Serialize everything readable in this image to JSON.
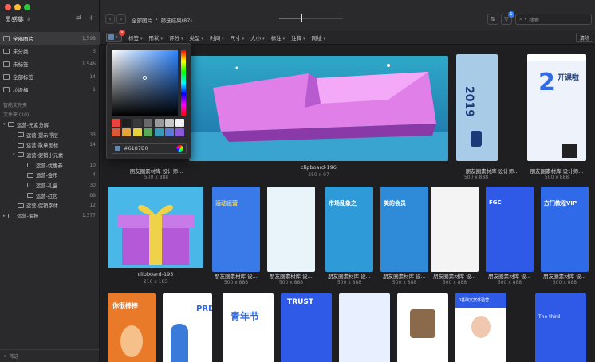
{
  "sidebar": {
    "library_title": "灵感集",
    "nav": [
      {
        "label": "全部图片",
        "count": "1,598"
      },
      {
        "label": "未分类",
        "count": "3"
      },
      {
        "label": "未标签",
        "count": "1,546"
      },
      {
        "label": "全部标签",
        "count": "14"
      },
      {
        "label": "垃圾桶",
        "count": "1"
      }
    ],
    "smart_folders_title": "智能文件夹",
    "folders_title": "文件夹 (10)",
    "folders": [
      {
        "label": "运营-元素分解",
        "count": "",
        "level": 0,
        "expand": "open"
      },
      {
        "label": "运营-提示浮层",
        "count": "33",
        "level": 1,
        "expand": "none"
      },
      {
        "label": "运营-散章图标",
        "count": "14",
        "level": 1,
        "expand": "none"
      },
      {
        "label": "运营-促销小元素",
        "count": "",
        "level": 1,
        "expand": "open"
      },
      {
        "label": "运营-优惠券",
        "count": "10",
        "level": 2,
        "expand": "none"
      },
      {
        "label": "运营-金币",
        "count": "4",
        "level": 2,
        "expand": "none"
      },
      {
        "label": "运营-礼盒",
        "count": "30",
        "level": 2,
        "expand": "none"
      },
      {
        "label": "运营-红包",
        "count": "88",
        "level": 2,
        "expand": "none"
      },
      {
        "label": "运营-促销字体",
        "count": "12",
        "level": 1,
        "expand": "none"
      },
      {
        "label": "运营-海报",
        "count": "1,377",
        "level": 0,
        "expand": "closed"
      }
    ],
    "filter_placeholder": "筛选"
  },
  "toolbar": {
    "breadcrumb_root": "全部图片",
    "breadcrumb_sep": "›",
    "breadcrumb_current": "筛选结果(87)",
    "zoom_level": 0.35,
    "filter_badge": "1",
    "search_placeholder": "搜索"
  },
  "filterbar": {
    "options": [
      "标签",
      "形状",
      "评分",
      "类型",
      "时间",
      "尺寸",
      "大小",
      "标注",
      "注释",
      "网址"
    ],
    "clear_label": "清除"
  },
  "color_picker": {
    "hex": "#6187B0",
    "swatches": [
      "#e8433e",
      "#1f1f1f",
      "#3a3a3a",
      "#6a6a6a",
      "#9a9a9a",
      "#c8c8c8",
      "#f2f2f2",
      "#d85a3a",
      "#e8a23a",
      "#e8d23a",
      "#5aa85a",
      "#3a9ab8",
      "#5a7ad8",
      "#8a5ad8"
    ]
  },
  "items": [
    {
      "title": "朋友圈素材库 设计师...",
      "size": "500 x 888"
    },
    {
      "title": "clipboard-196",
      "size": "250 x 97"
    },
    {
      "title": "朋友圈素材库 设计师...",
      "size": "500 x 888"
    },
    {
      "title": "朋友圈素材库 设计师...",
      "size": "500 x 888"
    },
    {
      "title": "clipboard-195",
      "size": "216 x 185"
    },
    {
      "title": "朋友圈素材库 设...",
      "size": "500 x 888"
    },
    {
      "title": "朋友圈素材库 设...",
      "size": "500 x 888"
    },
    {
      "title": "朋友圈素材库 设...",
      "size": "500 x 888"
    },
    {
      "title": "朋友圈素材库 设...",
      "size": "500 x 888"
    },
    {
      "title": "朋友圈素材库 设...",
      "size": "500 x 888"
    },
    {
      "title": "朋友圈素材库 设...",
      "size": "500 x 888"
    },
    {
      "title": "朋友圈素材库 设...",
      "size": "500 x 888"
    }
  ],
  "thumb_text": {
    "y2019": "2019",
    "kaike": "开课啦",
    "huodong": "活动运营",
    "vip": "方门教程VIP",
    "fgc": "FGC",
    "meidi": "美的会员",
    "shichang": "市场乱象之",
    "nihenbang": "你很棒棒",
    "prd": "PRD",
    "qingnianjie": "青年节",
    "trust": "TRUST",
    "b0": "0基础文案体验营",
    "third": "The third"
  }
}
